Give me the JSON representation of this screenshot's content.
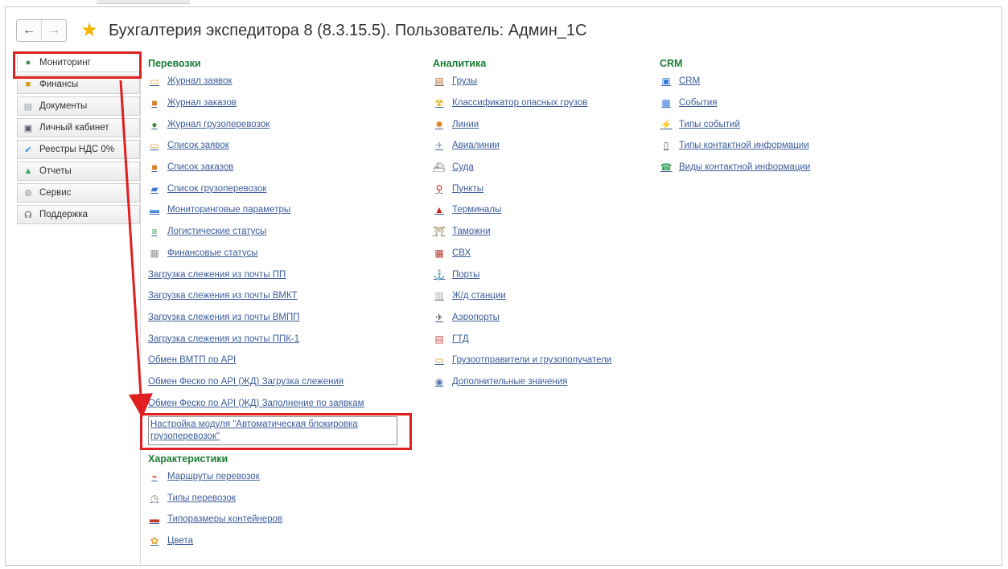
{
  "window": {
    "title": "Бухгалтерия экспедитора 8 (8.3.15.5). Пользователь: Админ_1С",
    "back_icon": "←",
    "forward_icon": "→",
    "favorite_icon": "★"
  },
  "sidebar": {
    "items": [
      {
        "label": "Мониторинг",
        "icon": "globe-icon",
        "glyph": "●",
        "color": "#3c8a3c"
      },
      {
        "label": "Финансы",
        "icon": "coins-icon",
        "glyph": "■",
        "color": "#d4a017"
      },
      {
        "label": "Документы",
        "icon": "document-icon",
        "glyph": "▤",
        "color": "#9aa0a6"
      },
      {
        "label": "Личный кабинет",
        "icon": "monitor-icon",
        "glyph": "▣",
        "color": "#556"
      },
      {
        "label": "Реестры НДС 0%",
        "icon": "checkmark-folder-icon",
        "glyph": "✔",
        "color": "#3a8bd9"
      },
      {
        "label": "Отчеты",
        "icon": "chart-icon",
        "glyph": "▲",
        "color": "#3aa05a"
      },
      {
        "label": "Сервис",
        "icon": "gear-icon",
        "glyph": "⚙",
        "color": "#888"
      },
      {
        "label": "Поддержка",
        "icon": "headset-icon",
        "glyph": "☊",
        "color": "#555"
      }
    ]
  },
  "columns": {
    "transport": {
      "heading": "Перевозки",
      "links": [
        {
          "label": "Журнал заявок",
          "icon": "folder-icon",
          "glyph": "▭",
          "color": "#e0a040"
        },
        {
          "label": "Журнал заказов",
          "icon": "package-icon",
          "glyph": "■",
          "color": "#d9822b"
        },
        {
          "label": "Журнал грузоперевозок",
          "icon": "globe-icon",
          "glyph": "●",
          "color": "#3c8a3c"
        },
        {
          "label": "Список заявок",
          "icon": "folder-icon",
          "glyph": "▭",
          "color": "#e0a040"
        },
        {
          "label": "Список заказов",
          "icon": "package-icon",
          "glyph": "■",
          "color": "#d9822b"
        },
        {
          "label": "Список грузоперевозок",
          "icon": "truck-icon",
          "glyph": "▰",
          "color": "#3a7bd5"
        },
        {
          "label": "Мониторинговые параметры",
          "icon": "panel-icon",
          "glyph": "▬",
          "color": "#4a90d9"
        },
        {
          "label": "Логистические статусы",
          "icon": "stack-icon",
          "glyph": "≡",
          "color": "#3a9a5a"
        },
        {
          "label": "Финансовые статусы",
          "icon": "grid-icon",
          "glyph": "▦",
          "color": "#999"
        },
        {
          "label": "Загрузка слежения из почты ПП",
          "icon": "",
          "glyph": "",
          "color": ""
        },
        {
          "label": "Загрузка слежения из почты ВМКТ",
          "icon": "",
          "glyph": "",
          "color": ""
        },
        {
          "label": "Загрузка слежения из почты ВМПП",
          "icon": "",
          "glyph": "",
          "color": ""
        },
        {
          "label": "Загрузка слежения из почты ППК-1",
          "icon": "",
          "glyph": "",
          "color": ""
        },
        {
          "label": "Обмен ВМТП по API",
          "icon": "",
          "glyph": "",
          "color": ""
        },
        {
          "label": "Обмен Феско по API (ЖД) Загрузка слежения",
          "icon": "",
          "glyph": "",
          "color": ""
        },
        {
          "label": "Обмен Феско по API (ЖД) Заполнение по заявкам",
          "icon": "",
          "glyph": "",
          "color": ""
        }
      ],
      "special_link": "Настройка модуля \"Автоматическая блокировка грузоперевозок\""
    },
    "characteristics": {
      "heading": "Характеристики",
      "links": [
        {
          "label": "Маршруты перевозок",
          "icon": "route-icon",
          "glyph": "⌁",
          "color": "#c0392b"
        },
        {
          "label": "Типы перевозок",
          "icon": "clock-icon",
          "glyph": "◷",
          "color": "#888"
        },
        {
          "label": "Типоразмеры контейнеров",
          "icon": "container-icon",
          "glyph": "▬",
          "color": "#c0392b"
        },
        {
          "label": "Цвета",
          "icon": "palette-icon",
          "glyph": "✿",
          "color": "#e0a030"
        }
      ]
    },
    "analytics": {
      "heading": "Аналитика",
      "links": [
        {
          "label": "Грузы",
          "icon": "cargo-icon",
          "glyph": "▤",
          "color": "#b07030"
        },
        {
          "label": "Классификатор опасных грузов",
          "icon": "radiation-icon",
          "glyph": "☢",
          "color": "#e0b000"
        },
        {
          "label": "Линии",
          "icon": "gear-icon",
          "glyph": "✹",
          "color": "#d9822b"
        },
        {
          "label": "Авиалинии",
          "icon": "plane-icon",
          "glyph": "✈",
          "color": "#9aa0a6"
        },
        {
          "label": "Суда",
          "icon": "ship-icon",
          "glyph": "⛴",
          "color": "#888"
        },
        {
          "label": "Пункты",
          "icon": "map-pin-icon",
          "glyph": "⚲",
          "color": "#d02020"
        },
        {
          "label": "Терминалы",
          "icon": "terminal-icon",
          "glyph": "▲",
          "color": "#d02020"
        },
        {
          "label": "Таможни",
          "icon": "customs-icon",
          "glyph": "⛩",
          "color": "#8a6a30"
        },
        {
          "label": "СВХ",
          "icon": "warehouse-icon",
          "glyph": "▦",
          "color": "#c03030"
        },
        {
          "label": "Порты",
          "icon": "anchor-icon",
          "glyph": "⚓",
          "color": "#777"
        },
        {
          "label": "Ж/д станции",
          "icon": "rail-icon",
          "glyph": "▥",
          "color": "#aaa"
        },
        {
          "label": "Аэропорты",
          "icon": "airport-icon",
          "glyph": "✈",
          "color": "#6a6a6a"
        },
        {
          "label": "ГТД",
          "icon": "declaration-icon",
          "glyph": "▤",
          "color": "#d05050"
        },
        {
          "label": "Грузоотправители и грузополучатели",
          "icon": "folder-icon",
          "glyph": "▭",
          "color": "#e0a040"
        },
        {
          "label": "Дополнительные значения",
          "icon": "values-icon",
          "glyph": "◉",
          "color": "#5a7ab0"
        }
      ]
    },
    "crm": {
      "heading": "CRM",
      "links": [
        {
          "label": "CRM",
          "icon": "crm-icon",
          "glyph": "▣",
          "color": "#3a7bd5"
        },
        {
          "label": "События",
          "icon": "calendar-icon",
          "glyph": "▦",
          "color": "#3a7bd5"
        },
        {
          "label": "Типы событий",
          "icon": "lightning-icon",
          "glyph": "⚡",
          "color": "#e0b000"
        },
        {
          "label": "Типы контактной информации",
          "icon": "phone-icon",
          "glyph": "▯",
          "color": "#666"
        },
        {
          "label": "Виды контактной информации",
          "icon": "contact-icon",
          "glyph": "☎",
          "color": "#3aa05a"
        }
      ]
    }
  },
  "colors": {
    "highlight": "#e02020",
    "section_heading": "#1a7c33",
    "link": "#3d5d9a"
  }
}
